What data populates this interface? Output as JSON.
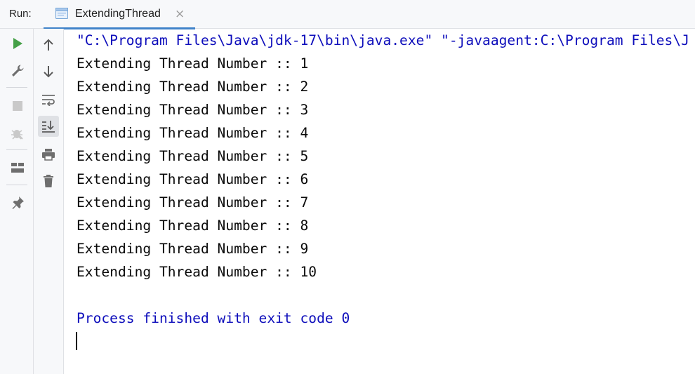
{
  "run_panel": {
    "label": "Run:",
    "tab": {
      "title": "ExtendingThread",
      "close_glyph": "×"
    }
  },
  "toolbar": {
    "left": [
      "rerun-icon",
      "settings-icon",
      "stop-icon",
      "debug-icon",
      "layout-icon",
      "pin-icon"
    ],
    "right": [
      "up-arrow-icon",
      "down-arrow-icon",
      "soft-wrap-icon",
      "scroll-to-end-icon",
      "print-icon",
      "trash-icon"
    ]
  },
  "console": {
    "command_line": "\"C:\\Program Files\\Java\\jdk-17\\bin\\java.exe\" \"-javaagent:C:\\Program Files\\J",
    "output_lines": [
      "Extending Thread Number :: 1",
      "Extending Thread Number :: 2",
      "Extending Thread Number :: 3",
      "Extending Thread Number :: 4",
      "Extending Thread Number :: 5",
      "Extending Thread Number :: 6",
      "Extending Thread Number :: 7",
      "Extending Thread Number :: 8",
      "Extending Thread Number :: 9",
      "Extending Thread Number :: 10"
    ],
    "exit_message": "Process finished with exit code 0"
  },
  "colors": {
    "accent": "#4083c9",
    "run_green": "#45a047",
    "icon_gray": "#6e6e6e",
    "console_blue": "#0d0dbb"
  }
}
